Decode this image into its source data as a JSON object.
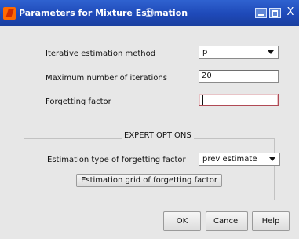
{
  "window": {
    "title": "Parameters for Mixture Estimation",
    "close_glyph": "X"
  },
  "form": {
    "method_label": "Iterative estimation method",
    "method_value": "p",
    "iterations_label": "Maximum number of iterations",
    "iterations_value": "20",
    "forgetting_label": "Forgetting factor",
    "forgetting_value": ""
  },
  "expert": {
    "title": "EXPERT OPTIONS",
    "estimation_type_label": "Estimation type of forgetting factor",
    "estimation_type_value": "prev estimate",
    "grid_button_label": "Estimation grid of forgetting factor"
  },
  "buttons": {
    "ok": "OK",
    "cancel": "Cancel",
    "help": "Help"
  },
  "icons": {
    "app": "matlab-icon",
    "busy": "busy-spinner-icon",
    "minimize": "minimize-icon",
    "maximize": "maximize-icon",
    "close": "close-icon",
    "dropdown": "chevron-down-icon"
  },
  "colors": {
    "titlebar": "#1e49b8",
    "dialog_bg": "#e7e7e7",
    "focus_border": "#b04a55"
  }
}
